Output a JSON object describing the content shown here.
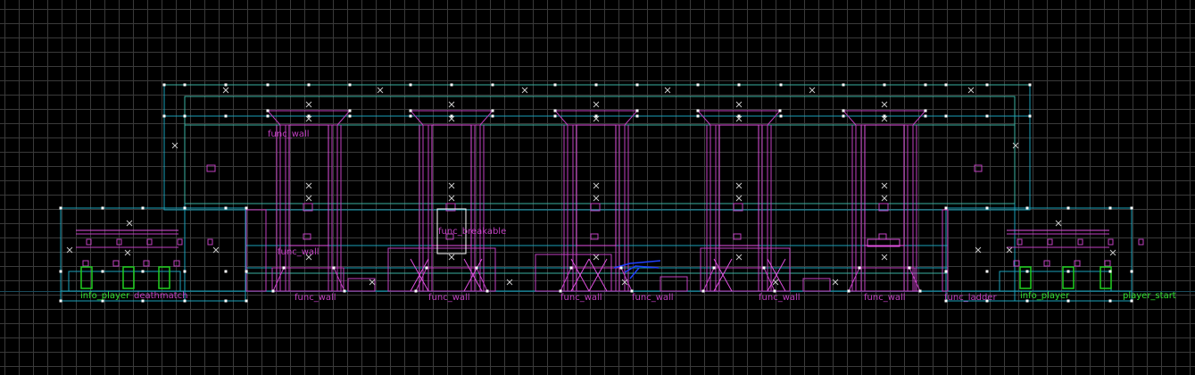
{
  "view": {
    "name": "2D orthographic view",
    "colors": {
      "background": "#000000",
      "grid": "#3a3a3a",
      "grid_major": "#4a4a4a",
      "axis": "#1a4a5a",
      "brush_cyan": "#1aa0b8",
      "brush_teal": "#3ab0a0",
      "entity_magenta": "#c040c0",
      "entity_magenta_bright": "#e050e0",
      "player_start_green": "#20d020",
      "selection_blue": "#2040ff",
      "vertex_white": "#ffffff",
      "label_magenta": "#c040c0",
      "label_green": "#30e030"
    }
  },
  "labels": {
    "func_wall_top": "func_wall",
    "func_breakable": "func_breakable",
    "func_wall_mid": "func_wall",
    "info_player_left": "info_player",
    "info_player_left_overlap": "deathmatch",
    "func_wall_bottom_left": "func_wall",
    "func_wall_bottom_2": "func_wall",
    "func_wall_bottom_3a": "func_wall",
    "func_wall_bottom_3b": "func_wall",
    "func_wall_bottom_4": "func_wall",
    "func_wall_bottom_5": "func_wall",
    "func_ladder": "func_ladder",
    "info_player_right": "info_player",
    "info_player_start": "player_start"
  }
}
